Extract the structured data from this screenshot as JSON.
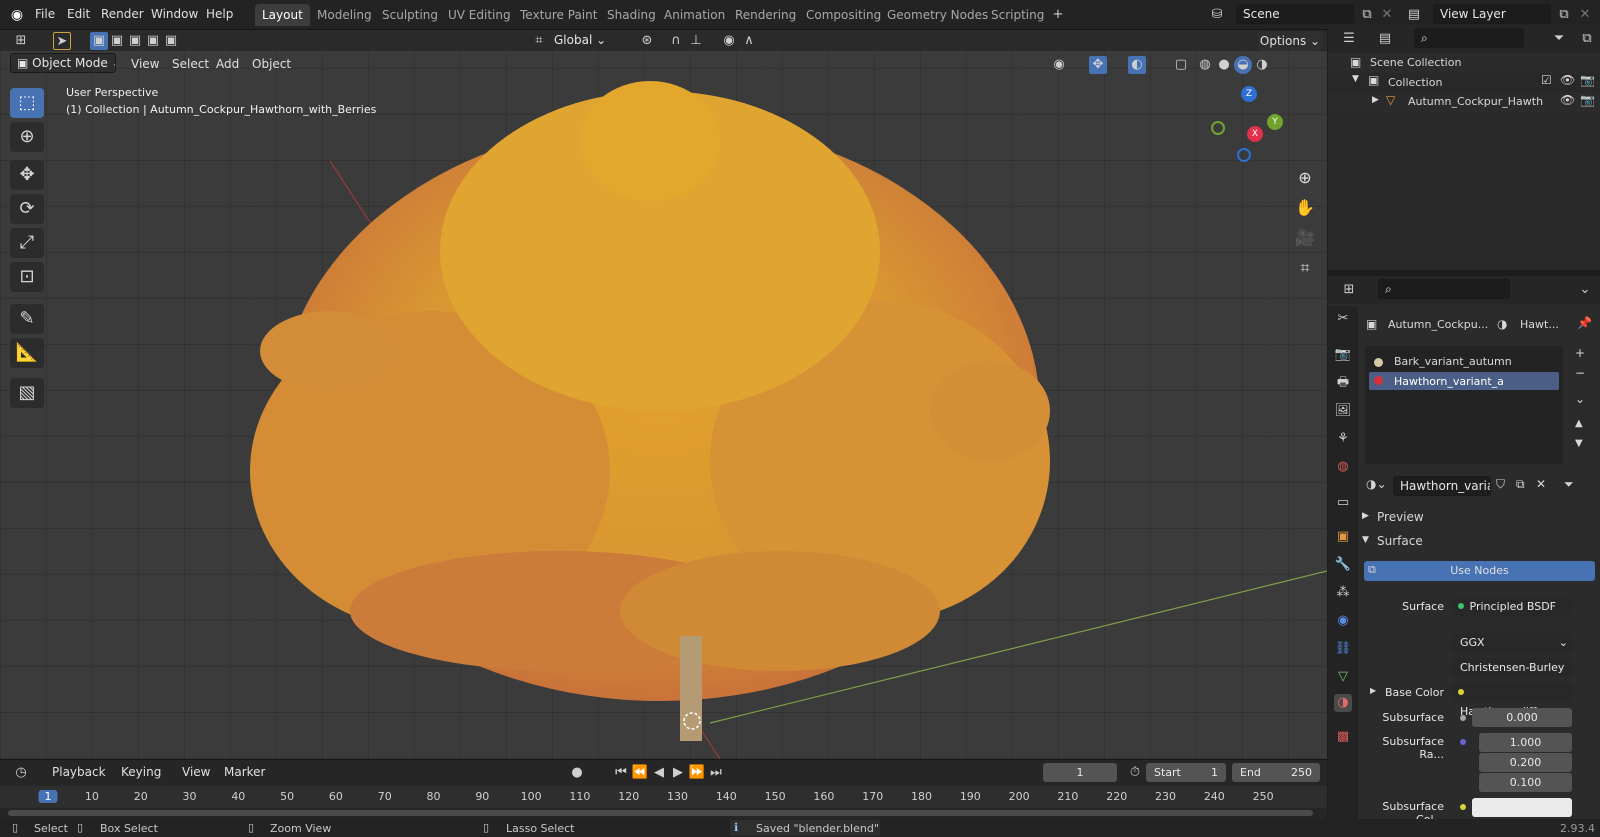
{
  "menu": {
    "file": "File",
    "edit": "Edit",
    "render": "Render",
    "window": "Window",
    "help": "Help"
  },
  "workspaces": [
    "Layout",
    "Modeling",
    "Sculpting",
    "UV Editing",
    "Texture Paint",
    "Shading",
    "Animation",
    "Rendering",
    "Compositing",
    "Geometry Nodes",
    "Scripting"
  ],
  "scene_name": "Scene",
  "view_layer": "View Layer",
  "toolbar": {
    "transform_orientation": "Global",
    "options": "Options"
  },
  "viewport_header": {
    "mode": "Object Mode",
    "view": "View",
    "select": "Select",
    "add": "Add",
    "object": "Object"
  },
  "viewport": {
    "perspective": "User Perspective",
    "collection_line": "(1) Collection | Autumn_Cockpur_Hawthorn_with_Berries",
    "gizmo": {
      "z": "Z",
      "y": "Y",
      "x": "X"
    }
  },
  "outliner": {
    "scene_collection": "Scene Collection",
    "collection": "Collection",
    "object": "Autumn_Cockpur_Hawth"
  },
  "properties": {
    "object_name": "Autumn_Cockpu...",
    "material_short": "Hawt...",
    "material_slots": [
      "Bark_variant_autumn",
      "Hawthorn_variant_a"
    ],
    "material_field": "Hawthorn_varia...",
    "preview": "Preview",
    "surface_panel": "Surface",
    "use_nodes": "Use Nodes",
    "surface_label": "Surface",
    "surface_value": "Principled BSDF",
    "distribution": "GGX",
    "subsurface_method": "Christensen-Burley",
    "base_color_label": "Base Color",
    "base_color_value": "Hawthorn_diffuse....",
    "subsurface_label": "Subsurface",
    "subsurface_value": "0.000",
    "subsurface_radius_label": "Subsurface Ra...",
    "subsurface_radius": [
      "1.000",
      "0.200",
      "0.100"
    ],
    "subsurface_color_label": "Subsurface Col..."
  },
  "timeline": {
    "playback": "Playback",
    "keying": "Keying",
    "view": "View",
    "marker": "Marker",
    "current_frame": "1",
    "start_label": "Start",
    "start": "1",
    "end_label": "End",
    "end": "250",
    "ticks": [
      "1",
      "10",
      "20",
      "30",
      "40",
      "50",
      "60",
      "70",
      "80",
      "90",
      "100",
      "110",
      "120",
      "130",
      "140",
      "150",
      "160",
      "170",
      "180",
      "190",
      "200",
      "210",
      "220",
      "230",
      "240",
      "250"
    ]
  },
  "status": {
    "select": "Select",
    "box_select": "Box Select",
    "zoom_view": "Zoom View",
    "lasso_select": "Lasso Select",
    "message": "Saved \"blender.blend\"",
    "version": "2.93.4"
  },
  "colors": {
    "accent": "#4772b3",
    "x_axis": "#ff3352",
    "y_axis": "#8bdc00",
    "z_axis": "#2890ff"
  }
}
